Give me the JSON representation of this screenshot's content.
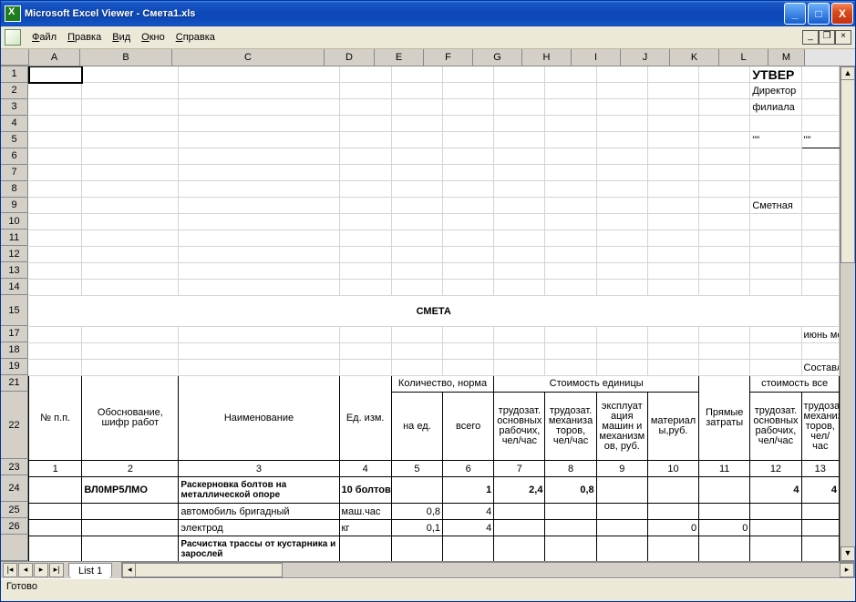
{
  "window": {
    "title": "Microsoft Excel Viewer - Смета1.xls"
  },
  "menu": {
    "file": "Файл",
    "edit": "Правка",
    "view": "Вид",
    "window": "Окно",
    "help": "Справка"
  },
  "cols": [
    "A",
    "B",
    "C",
    "D",
    "E",
    "F",
    "G",
    "H",
    "I",
    "J",
    "K",
    "L",
    "M"
  ],
  "rows": [
    "1",
    "2",
    "3",
    "4",
    "5",
    "6",
    "7",
    "8",
    "9",
    "10",
    "11",
    "12",
    "13",
    "14",
    "15",
    "17",
    "18",
    "19",
    "21",
    "22",
    "23",
    "24",
    "25",
    "26",
    ""
  ],
  "content": {
    "L1": "УТВЕР",
    "L2": "Директор",
    "L3": "филиала",
    "L5": "\"\"",
    "M5": "\"\"",
    "L9": "Сметная",
    "title": "СМЕТА",
    "M17": "июнь ме",
    "M19": "Составле",
    "h_kol": "Количество, норма",
    "h_stoim": "Стоимость единицы",
    "h_stoim_vse": "стоимость все",
    "h_npp": "№ п.п.",
    "h_obosn": "Обоснование, шифр работ",
    "h_naim": "Наименование",
    "h_ed": "Ед. изм.",
    "h_naed": "на ед.",
    "h_vsego": "всего",
    "h_tr_osn": "трудозат. основных рабочих, чел/час",
    "h_tr_mex": "трудозат. механиза торов, чел/час",
    "h_ekspl": "эксплуат ация машин и механизм ов, руб.",
    "h_mat": "материал ы,руб.",
    "h_pryam": "Прямые затраты",
    "n1": "1",
    "n2": "2",
    "n3": "3",
    "n4": "4",
    "n5": "5",
    "n6": "6",
    "n7": "7",
    "n8": "8",
    "n9": "9",
    "n10": "10",
    "n11": "11",
    "n12": "12",
    "n13": "13",
    "r24_b": "ВЛ0МР5ЛМО",
    "r24_c": "Раскерновка болтов на металлической  опоре",
    "r24_d": "10 болтов",
    "r24_f": "1",
    "r24_g": "2,4",
    "r24_h": "0,8",
    "r24_l": "4",
    "r24_m": "4",
    "r25_c": "автомобиль бригадный",
    "r25_d": "маш.час",
    "r25_e": "0,8",
    "r25_f": "4",
    "r26_c": "электрод",
    "r26_d": "кг",
    "r26_e": "0,1",
    "r26_f": "4",
    "r26_j": "0",
    "r26_k": "0",
    "r27_c": "Расчистка трассы от кустарника и зарослей"
  },
  "tabs": {
    "sheet1": "List 1"
  },
  "status": "Готово"
}
